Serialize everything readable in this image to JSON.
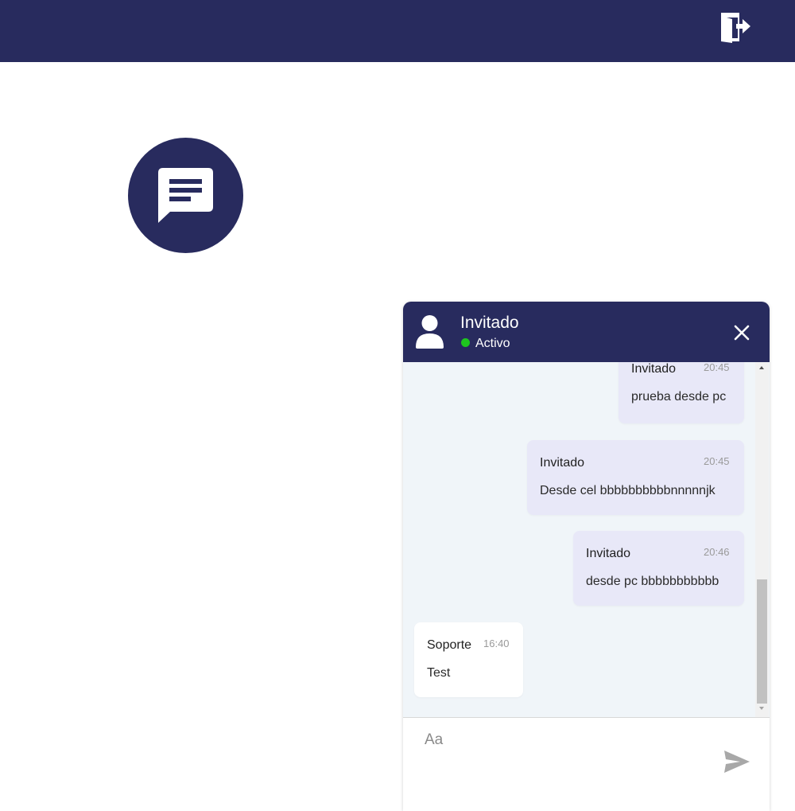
{
  "topbar": {
    "logout_icon": "logout-door-icon",
    "color": "#282b5e"
  },
  "chat_fab": {
    "icon": "chat-bubble-icon"
  },
  "chat": {
    "header": {
      "name": "Invitado",
      "status": "Activo",
      "status_color": "#1ec71e"
    },
    "messages": [
      {
        "sender": "Invitado",
        "time": "20:45",
        "text": "prueba desde pc",
        "side": "right"
      },
      {
        "sender": "Invitado",
        "time": "20:45",
        "text": "Desde cel bbbbbbbbbbnnnnnjk",
        "side": "right"
      },
      {
        "sender": "Invitado",
        "time": "20:46",
        "text": "desde pc bbbbbbbbbbb",
        "side": "right"
      },
      {
        "sender": "Soporte",
        "time": "16:40",
        "text": "Test",
        "side": "left"
      }
    ],
    "composer": {
      "placeholder": "Aa",
      "send_icon": "send-icon"
    }
  }
}
